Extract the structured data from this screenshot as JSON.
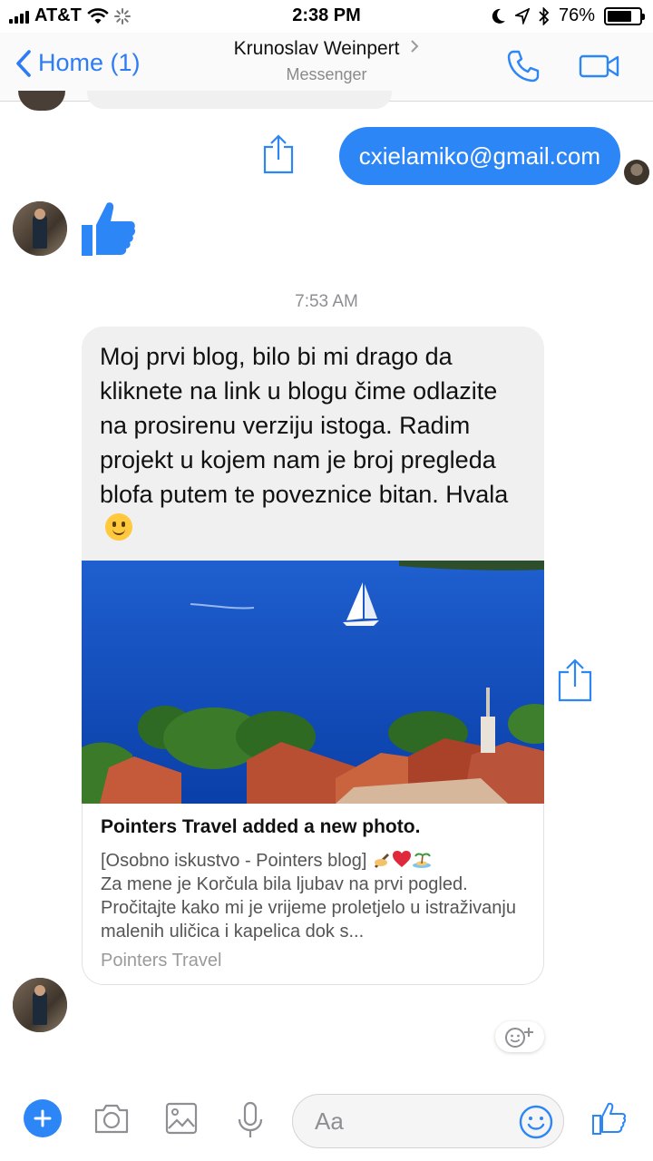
{
  "status_bar": {
    "carrier": "AT&T",
    "time": "2:38 PM",
    "battery": "76%",
    "battery_level": 0.76
  },
  "nav": {
    "back_label": "Home (1)",
    "contact_name": "Krunoslav Weinpert",
    "subtitle": "Messenger"
  },
  "messages": {
    "outgoing_email": "cxielamiko@gmail.com",
    "timestamp": "7:53 AM",
    "incoming_text": "Moj prvi blog, bilo bi mi drago da kliknete na link u blogu čime odlazite na prosirenu verziju istoga. Radim projekt u kojem nam je broj pregleda blofa putem te poveznice bitan. Hvala"
  },
  "link_card": {
    "title": "Pointers Travel added a new photo.",
    "desc_line1": "[Osobno iskustvo - Pointers blog]",
    "desc_rest": "Za mene je Korčula bila ljubav na prvi pogled.",
    "desc_rest2": "Pročitajte kako mi je vrijeme proletjelo u istraživanju malenih uličica i kapelica dok s...",
    "source": "Pointers Travel"
  },
  "composer": {
    "placeholder": "Aa"
  },
  "colors": {
    "accent": "#2d86f6",
    "bubble_incoming": "#f1f0f0"
  }
}
